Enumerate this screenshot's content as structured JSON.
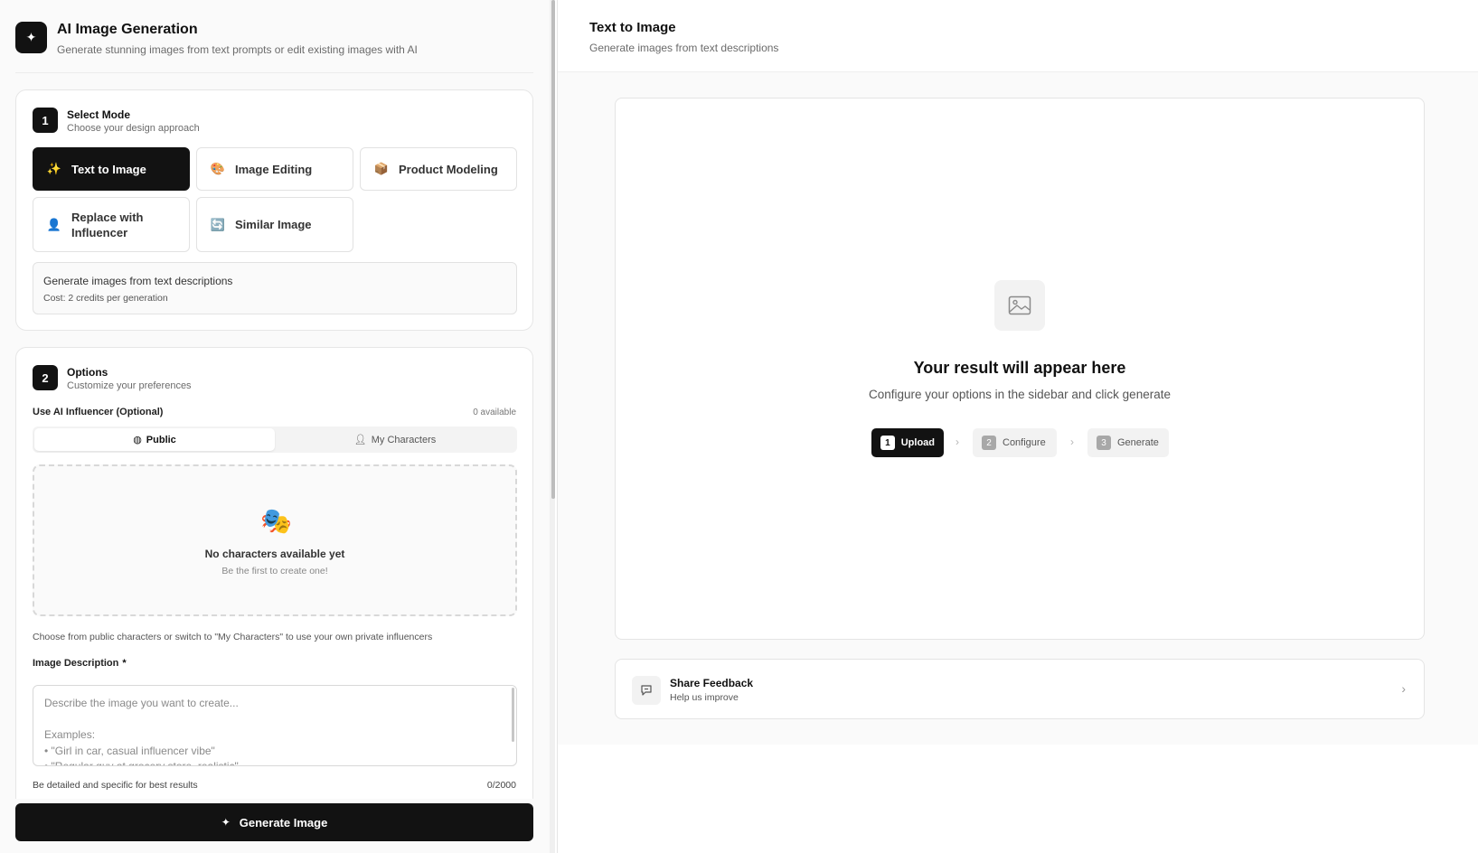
{
  "app": {
    "title": "AI Image Generation",
    "subtitle": "Generate stunning images from text prompts or edit existing images with AI",
    "logo_icon": "sparkle-icon"
  },
  "step1": {
    "number": "1",
    "title": "Select Mode",
    "subtitle": "Choose your design approach",
    "modes": [
      {
        "label": "Text to Image",
        "icon": "sparkles-icon",
        "glyph": "✨",
        "active": true
      },
      {
        "label": "Image Editing",
        "icon": "palette-icon",
        "glyph": "🎨",
        "active": false
      },
      {
        "label": "Product Modeling",
        "icon": "package-icon",
        "glyph": "📦",
        "active": false
      },
      {
        "label": "Replace with Influencer",
        "icon": "person-icon",
        "glyph": "👤",
        "active": false
      },
      {
        "label": "Similar Image",
        "icon": "refresh-icon",
        "glyph": "🔄",
        "active": false
      }
    ],
    "description": "Generate images from text descriptions",
    "cost": "Cost: 2 credits per generation"
  },
  "step2": {
    "number": "2",
    "title": "Options",
    "subtitle": "Customize your preferences",
    "influencer_label": "Use AI Influencer (Optional)",
    "available": "0 available",
    "tabs": [
      {
        "label": "Public",
        "icon": "globe-icon",
        "active": true
      },
      {
        "label": "My Characters",
        "icon": "user-icon",
        "active": false
      }
    ],
    "empty_icon": "theater-masks-icon",
    "empty_title": "No characters available yet",
    "empty_sub": "Be the first to create one!",
    "help": "Choose from public characters or switch to \"My Characters\" to use your own private influencers",
    "desc_label": "Image Description",
    "required_mark": "*",
    "placeholder": "Describe the image you want to create...\n\nExamples:\n• \"Girl in car, casual influencer vibe\"\n• \"Regular guy at grocery store, realistic\"",
    "hint": "Be detailed and specific for best results",
    "counter": "0/2000"
  },
  "generate_button": "Generate Image",
  "main": {
    "title": "Text to Image",
    "subtitle": "Generate images from text descriptions",
    "result_title": "Your result will appear here",
    "result_sub": "Configure your options in the sidebar and click generate",
    "flow": [
      {
        "num": "1",
        "label": "Upload",
        "active": true
      },
      {
        "num": "2",
        "label": "Configure",
        "active": false
      },
      {
        "num": "3",
        "label": "Generate",
        "active": false
      }
    ],
    "feedback_title": "Share Feedback",
    "feedback_sub": "Help us improve"
  },
  "colors": {
    "primary": "#121212",
    "background": "#fafafa",
    "border": "#e6e6e6"
  }
}
